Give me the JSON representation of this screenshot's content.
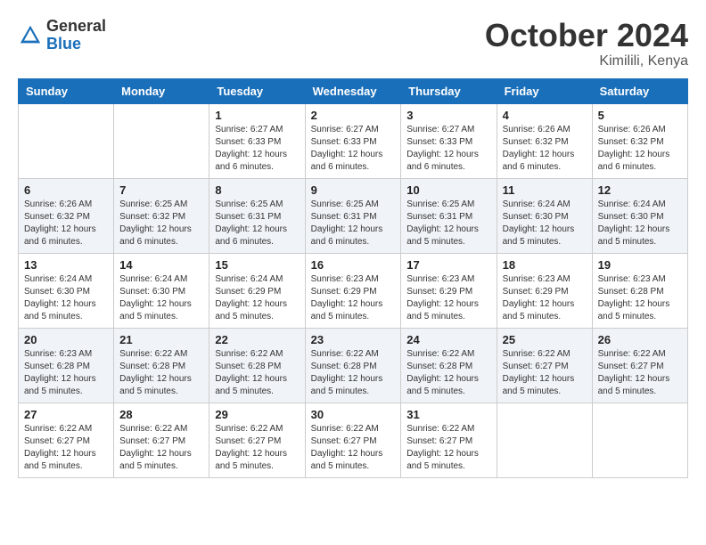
{
  "logo": {
    "general": "General",
    "blue": "Blue"
  },
  "title": "October 2024",
  "location": "Kimilili, Kenya",
  "days_of_week": [
    "Sunday",
    "Monday",
    "Tuesday",
    "Wednesday",
    "Thursday",
    "Friday",
    "Saturday"
  ],
  "weeks": [
    [
      {
        "day": "",
        "info": ""
      },
      {
        "day": "",
        "info": ""
      },
      {
        "day": "1",
        "info": "Sunrise: 6:27 AM\nSunset: 6:33 PM\nDaylight: 12 hours and 6 minutes."
      },
      {
        "day": "2",
        "info": "Sunrise: 6:27 AM\nSunset: 6:33 PM\nDaylight: 12 hours and 6 minutes."
      },
      {
        "day": "3",
        "info": "Sunrise: 6:27 AM\nSunset: 6:33 PM\nDaylight: 12 hours and 6 minutes."
      },
      {
        "day": "4",
        "info": "Sunrise: 6:26 AM\nSunset: 6:32 PM\nDaylight: 12 hours and 6 minutes."
      },
      {
        "day": "5",
        "info": "Sunrise: 6:26 AM\nSunset: 6:32 PM\nDaylight: 12 hours and 6 minutes."
      }
    ],
    [
      {
        "day": "6",
        "info": "Sunrise: 6:26 AM\nSunset: 6:32 PM\nDaylight: 12 hours and 6 minutes."
      },
      {
        "day": "7",
        "info": "Sunrise: 6:25 AM\nSunset: 6:32 PM\nDaylight: 12 hours and 6 minutes."
      },
      {
        "day": "8",
        "info": "Sunrise: 6:25 AM\nSunset: 6:31 PM\nDaylight: 12 hours and 6 minutes."
      },
      {
        "day": "9",
        "info": "Sunrise: 6:25 AM\nSunset: 6:31 PM\nDaylight: 12 hours and 6 minutes."
      },
      {
        "day": "10",
        "info": "Sunrise: 6:25 AM\nSunset: 6:31 PM\nDaylight: 12 hours and 5 minutes."
      },
      {
        "day": "11",
        "info": "Sunrise: 6:24 AM\nSunset: 6:30 PM\nDaylight: 12 hours and 5 minutes."
      },
      {
        "day": "12",
        "info": "Sunrise: 6:24 AM\nSunset: 6:30 PM\nDaylight: 12 hours and 5 minutes."
      }
    ],
    [
      {
        "day": "13",
        "info": "Sunrise: 6:24 AM\nSunset: 6:30 PM\nDaylight: 12 hours and 5 minutes."
      },
      {
        "day": "14",
        "info": "Sunrise: 6:24 AM\nSunset: 6:30 PM\nDaylight: 12 hours and 5 minutes."
      },
      {
        "day": "15",
        "info": "Sunrise: 6:24 AM\nSunset: 6:29 PM\nDaylight: 12 hours and 5 minutes."
      },
      {
        "day": "16",
        "info": "Sunrise: 6:23 AM\nSunset: 6:29 PM\nDaylight: 12 hours and 5 minutes."
      },
      {
        "day": "17",
        "info": "Sunrise: 6:23 AM\nSunset: 6:29 PM\nDaylight: 12 hours and 5 minutes."
      },
      {
        "day": "18",
        "info": "Sunrise: 6:23 AM\nSunset: 6:29 PM\nDaylight: 12 hours and 5 minutes."
      },
      {
        "day": "19",
        "info": "Sunrise: 6:23 AM\nSunset: 6:28 PM\nDaylight: 12 hours and 5 minutes."
      }
    ],
    [
      {
        "day": "20",
        "info": "Sunrise: 6:23 AM\nSunset: 6:28 PM\nDaylight: 12 hours and 5 minutes."
      },
      {
        "day": "21",
        "info": "Sunrise: 6:22 AM\nSunset: 6:28 PM\nDaylight: 12 hours and 5 minutes."
      },
      {
        "day": "22",
        "info": "Sunrise: 6:22 AM\nSunset: 6:28 PM\nDaylight: 12 hours and 5 minutes."
      },
      {
        "day": "23",
        "info": "Sunrise: 6:22 AM\nSunset: 6:28 PM\nDaylight: 12 hours and 5 minutes."
      },
      {
        "day": "24",
        "info": "Sunrise: 6:22 AM\nSunset: 6:28 PM\nDaylight: 12 hours and 5 minutes."
      },
      {
        "day": "25",
        "info": "Sunrise: 6:22 AM\nSunset: 6:27 PM\nDaylight: 12 hours and 5 minutes."
      },
      {
        "day": "26",
        "info": "Sunrise: 6:22 AM\nSunset: 6:27 PM\nDaylight: 12 hours and 5 minutes."
      }
    ],
    [
      {
        "day": "27",
        "info": "Sunrise: 6:22 AM\nSunset: 6:27 PM\nDaylight: 12 hours and 5 minutes."
      },
      {
        "day": "28",
        "info": "Sunrise: 6:22 AM\nSunset: 6:27 PM\nDaylight: 12 hours and 5 minutes."
      },
      {
        "day": "29",
        "info": "Sunrise: 6:22 AM\nSunset: 6:27 PM\nDaylight: 12 hours and 5 minutes."
      },
      {
        "day": "30",
        "info": "Sunrise: 6:22 AM\nSunset: 6:27 PM\nDaylight: 12 hours and 5 minutes."
      },
      {
        "day": "31",
        "info": "Sunrise: 6:22 AM\nSunset: 6:27 PM\nDaylight: 12 hours and 5 minutes."
      },
      {
        "day": "",
        "info": ""
      },
      {
        "day": "",
        "info": ""
      }
    ]
  ]
}
